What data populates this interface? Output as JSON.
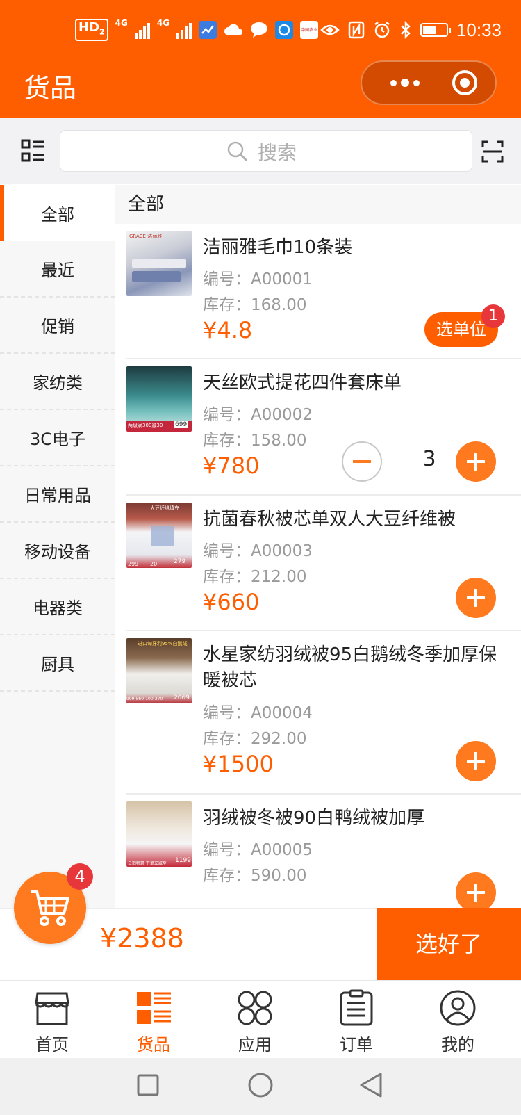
{
  "status_bar": {
    "hd_label": "HD",
    "hd_sub": "2",
    "net1": "4G",
    "net2": "4G",
    "app_icon_text": "中国农业",
    "more": "···",
    "time": "10:33"
  },
  "header": {
    "title": "货品"
  },
  "search": {
    "placeholder": "搜索"
  },
  "sidebar": {
    "items": [
      {
        "label": "全部",
        "active": true
      },
      {
        "label": "最近"
      },
      {
        "label": "促销"
      },
      {
        "label": "家纺类"
      },
      {
        "label": "3C电子"
      },
      {
        "label": "日常用品"
      },
      {
        "label": "移动设备"
      },
      {
        "label": "电器类"
      },
      {
        "label": "厨具"
      }
    ]
  },
  "list": {
    "section_title": "全部",
    "products": [
      {
        "name": "洁丽雅毛巾10条装",
        "code": "编号：A00001",
        "stock": "库存：168.00",
        "price": "¥4.8",
        "action": "选单位",
        "badge": "1",
        "thumb_text": "GRACE 洁丽雅"
      },
      {
        "name": "天丝欧式提花四件套床单",
        "code": "编号：A00002",
        "stock": "库存：158.00",
        "price": "¥780",
        "qty": "3",
        "thumb_text": "两级满300减30",
        "thumb_price": "699"
      },
      {
        "name": "抗菌春秋被芯单双人大豆纤维被",
        "code": "编号：A00003",
        "stock": "库存：212.00",
        "price": "¥660",
        "thumb_text": "大豆纤维填充",
        "thumb_price": "279",
        "thumb_left": "299",
        "thumb_mid": "20"
      },
      {
        "name": "水星家纺羽绒被95白鹅绒冬季加厚保暖被芯",
        "code": "编号：A00004",
        "stock": "库存：292.00",
        "price": "¥1500",
        "thumb_text": "进口匈牙利95%白鹅绒",
        "thumb_price": "2069",
        "thumb_left": "999-560-100-270"
      },
      {
        "name": "羽绒被冬被90白鸭绒被加厚",
        "code": "编号：A00005",
        "stock": "库存：590.00",
        "thumb_text": "云鹤特惠 下单立减至",
        "thumb_price": "1199"
      }
    ]
  },
  "cart": {
    "count": "4",
    "total": "¥2388",
    "done_label": "选好了"
  },
  "tabbar": {
    "items": [
      {
        "label": "首页",
        "icon": "store-icon"
      },
      {
        "label": "货品",
        "icon": "goods-icon",
        "active": true
      },
      {
        "label": "应用",
        "icon": "apps-icon"
      },
      {
        "label": "订单",
        "icon": "order-icon"
      },
      {
        "label": "我的",
        "icon": "user-icon"
      }
    ]
  },
  "colors": {
    "brand": "#ff5e00",
    "accent": "#ff7a1f",
    "badge": "#e8373b"
  }
}
